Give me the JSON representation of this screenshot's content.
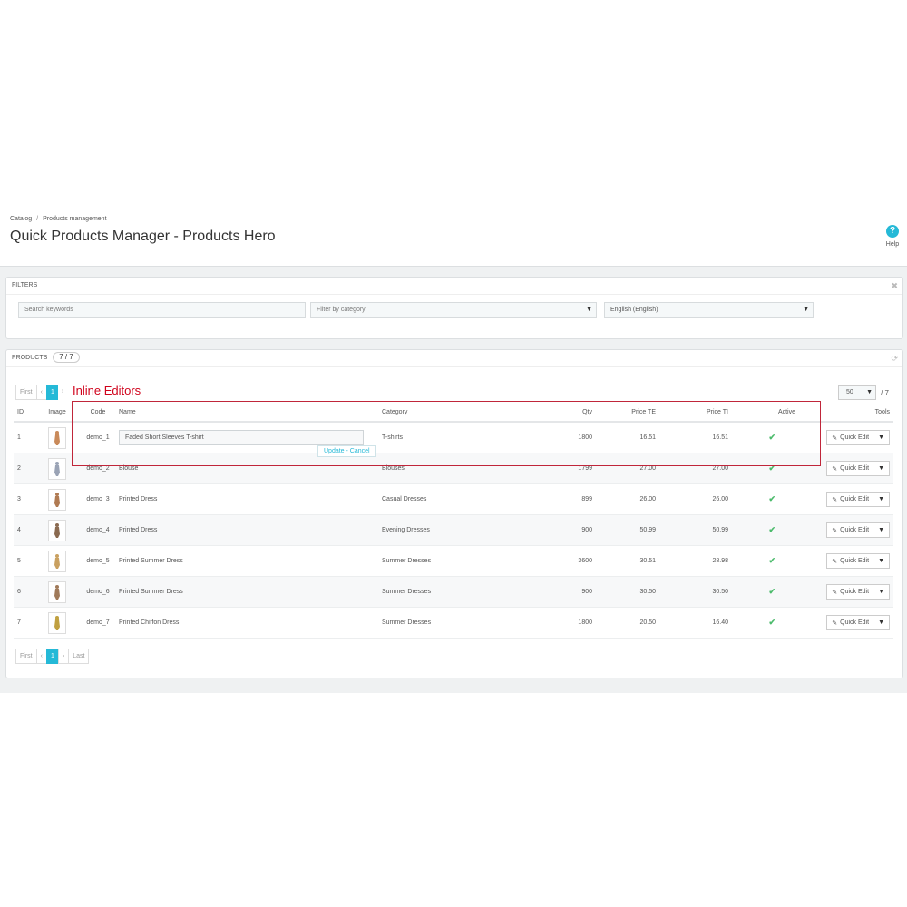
{
  "breadcrumb": [
    "Catalog",
    "Products management"
  ],
  "page_title": "Quick Products Manager - Products Hero",
  "help_label": "Help",
  "filters": {
    "heading": "Filters",
    "keywords_placeholder": "Search keywords",
    "category_value": "Filter by category",
    "language_value": "English (English)"
  },
  "products": {
    "heading": "Products",
    "count": "7 / 7",
    "annotation": "Inline Editors",
    "pagination_top": {
      "first": "First",
      "prev": "‹",
      "page": "1",
      "next": "›"
    },
    "pagination_bottom": {
      "first": "First",
      "prev": "‹",
      "page": "1",
      "next": "›",
      "last": "Last"
    },
    "per_page": "50",
    "per_page_total": "/ 7",
    "columns": {
      "id": "ID",
      "image": "Image",
      "code": "Code",
      "name": "Name",
      "category": "Category",
      "qty": "Qty",
      "price_te": "Price TE",
      "price_ti": "Price TI",
      "active": "Active",
      "tools": "Tools"
    },
    "inline_edit_value": "Faded Short Sleeves T-shirt",
    "inline_edit_actions": "Update - Cancel",
    "quick_edit_label": "Quick Edit",
    "rows": [
      {
        "id": "1",
        "code": "demo_1",
        "name": "",
        "category": "T-shirts",
        "qty": "1800",
        "price_te": "16.51",
        "price_ti": "16.51"
      },
      {
        "id": "2",
        "code": "demo_2",
        "name": "Blouse",
        "category": "Blouses",
        "qty": "1799",
        "price_te": "27.00",
        "price_ti": "27.00"
      },
      {
        "id": "3",
        "code": "demo_3",
        "name": "Printed Dress",
        "category": "Casual Dresses",
        "qty": "899",
        "price_te": "26.00",
        "price_ti": "26.00"
      },
      {
        "id": "4",
        "code": "demo_4",
        "name": "Printed Dress",
        "category": "Evening Dresses",
        "qty": "900",
        "price_te": "50.99",
        "price_ti": "50.99"
      },
      {
        "id": "5",
        "code": "demo_5",
        "name": "Printed Summer Dress",
        "category": "Summer Dresses",
        "qty": "3600",
        "price_te": "30.51",
        "price_ti": "28.98"
      },
      {
        "id": "6",
        "code": "demo_6",
        "name": "Printed Summer Dress",
        "category": "Summer Dresses",
        "qty": "900",
        "price_te": "30.50",
        "price_ti": "30.50"
      },
      {
        "id": "7",
        "code": "demo_7",
        "name": "Printed Chiffon Dress",
        "category": "Summer Dresses",
        "qty": "1800",
        "price_te": "20.50",
        "price_ti": "16.40"
      }
    ]
  },
  "colors": {
    "accent": "#25b9d7",
    "annotation": "#c0263a",
    "active_check": "#4cbb6c"
  },
  "icons": {
    "help": "question-circle-icon",
    "close": "close-icon",
    "refresh": "refresh-icon",
    "active": "check-icon",
    "quick_edit": "pencil-icon",
    "dropdown": "caret-down-icon"
  }
}
